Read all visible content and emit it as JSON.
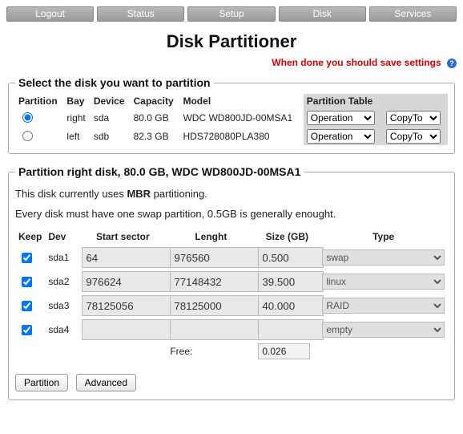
{
  "nav": [
    "Logout",
    "Status",
    "Setup",
    "Disk",
    "Services"
  ],
  "title": "Disk Partitioner",
  "warning": "When done you should save settings",
  "diskSelect": {
    "legend": "Select the disk you want to partition",
    "headers": {
      "partition": "Partition",
      "bay": "Bay",
      "device": "Device",
      "capacity": "Capacity",
      "model": "Model",
      "ptt": "Partition Table"
    },
    "opLabel": "Operation",
    "copyLabel": "CopyTo",
    "rows": [
      {
        "checked": true,
        "bay": "right",
        "dev": "sda",
        "cap": "80.0 GB",
        "model": "WDC WD800JD-00MSA1"
      },
      {
        "checked": false,
        "bay": "left",
        "dev": "sdb",
        "cap": "82.3 GB",
        "model": "HDS728080PLA380"
      }
    ]
  },
  "partition": {
    "legend": "Partition right disk, 80.0 GB, WDC WD800JD-00MSA1",
    "info1_a": "This disk currently uses ",
    "info1_b": "MBR",
    "info1_c": " partitioning.",
    "info2": "Every disk must have one swap partition, 0.5GB is generally enought.",
    "headers": {
      "keep": "Keep",
      "dev": "Dev",
      "start": "Start sector",
      "len": "Lenght",
      "size": "Size (GB)",
      "type": "Type"
    },
    "rows": [
      {
        "keep": true,
        "dev": "sda1",
        "start": "64",
        "len": "976560",
        "size": "0.500",
        "type": "swap"
      },
      {
        "keep": true,
        "dev": "sda2",
        "start": "976624",
        "len": "77148432",
        "size": "39.500",
        "type": "linux"
      },
      {
        "keep": true,
        "dev": "sda3",
        "start": "78125056",
        "len": "78125000",
        "size": "40.000",
        "type": "RAID"
      },
      {
        "keep": true,
        "dev": "sda4",
        "start": "",
        "len": "",
        "size": "",
        "type": "empty"
      }
    ],
    "freeLabel": "Free:",
    "freeValue": "0.026",
    "buttons": {
      "partition": "Partition",
      "advanced": "Advanced"
    }
  }
}
